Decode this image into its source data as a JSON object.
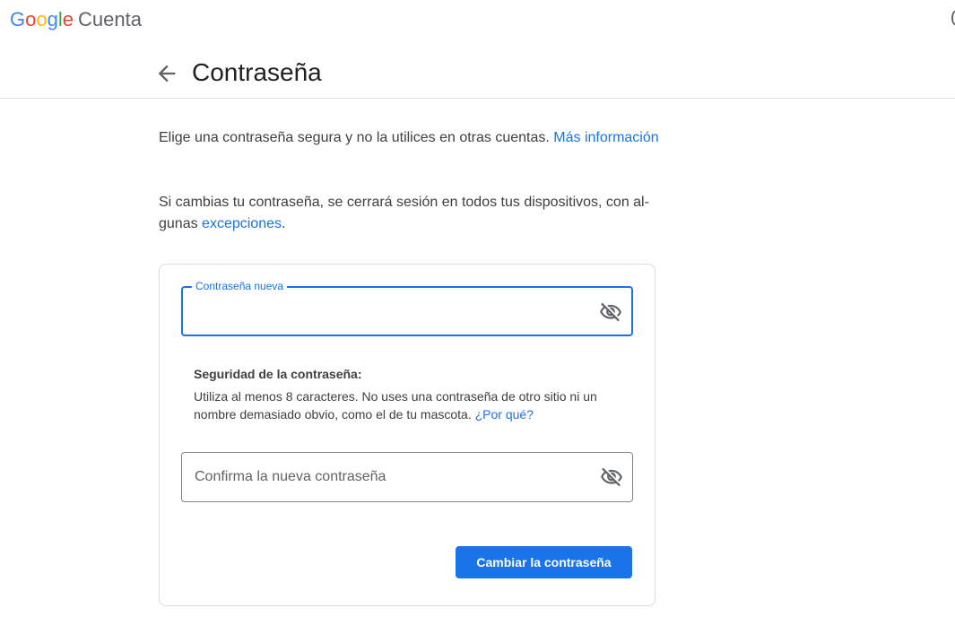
{
  "brand": {
    "logo_letters": [
      {
        "char": "G",
        "color": "#4285F4"
      },
      {
        "char": "o",
        "color": "#EA4335"
      },
      {
        "char": "o",
        "color": "#FBBC05"
      },
      {
        "char": "g",
        "color": "#4285F4"
      },
      {
        "char": "l",
        "color": "#34A853"
      },
      {
        "char": "e",
        "color": "#EA4335"
      }
    ],
    "logo_text": "Google",
    "product": "Cuenta"
  },
  "header": {
    "back_icon": "arrow-back-icon",
    "title": "Contraseña"
  },
  "intro": {
    "text": "Elige una contraseña segura y no la utilices en otras cuentas. ",
    "link": "Más información"
  },
  "signout_note": {
    "text": "Si cambias tu contraseña, se cerrará sesión en todos tus dispositivos, con al­gunas ",
    "link": "excepciones",
    "suffix": "."
  },
  "form": {
    "new_password": {
      "label": "Contraseña nueva",
      "value": "",
      "icon": "visibility-off-icon"
    },
    "strength": {
      "title": "Seguridad de la contraseña:",
      "text": "Utiliza al menos 8 caracteres. No uses una contraseña de otro sitio ni un nombre demasiado obvio, como el de tu mascota. ",
      "link": "¿Por qué?"
    },
    "confirm_password": {
      "placeholder": "Confirma la nueva contraseña",
      "value": "",
      "icon": "visibility-off-icon"
    },
    "submit_label": "Cambiar la contraseña"
  },
  "colors": {
    "accent": "#1a73e8",
    "text": "#202124",
    "secondary_text": "#3c4043",
    "border": "#dadce0"
  }
}
